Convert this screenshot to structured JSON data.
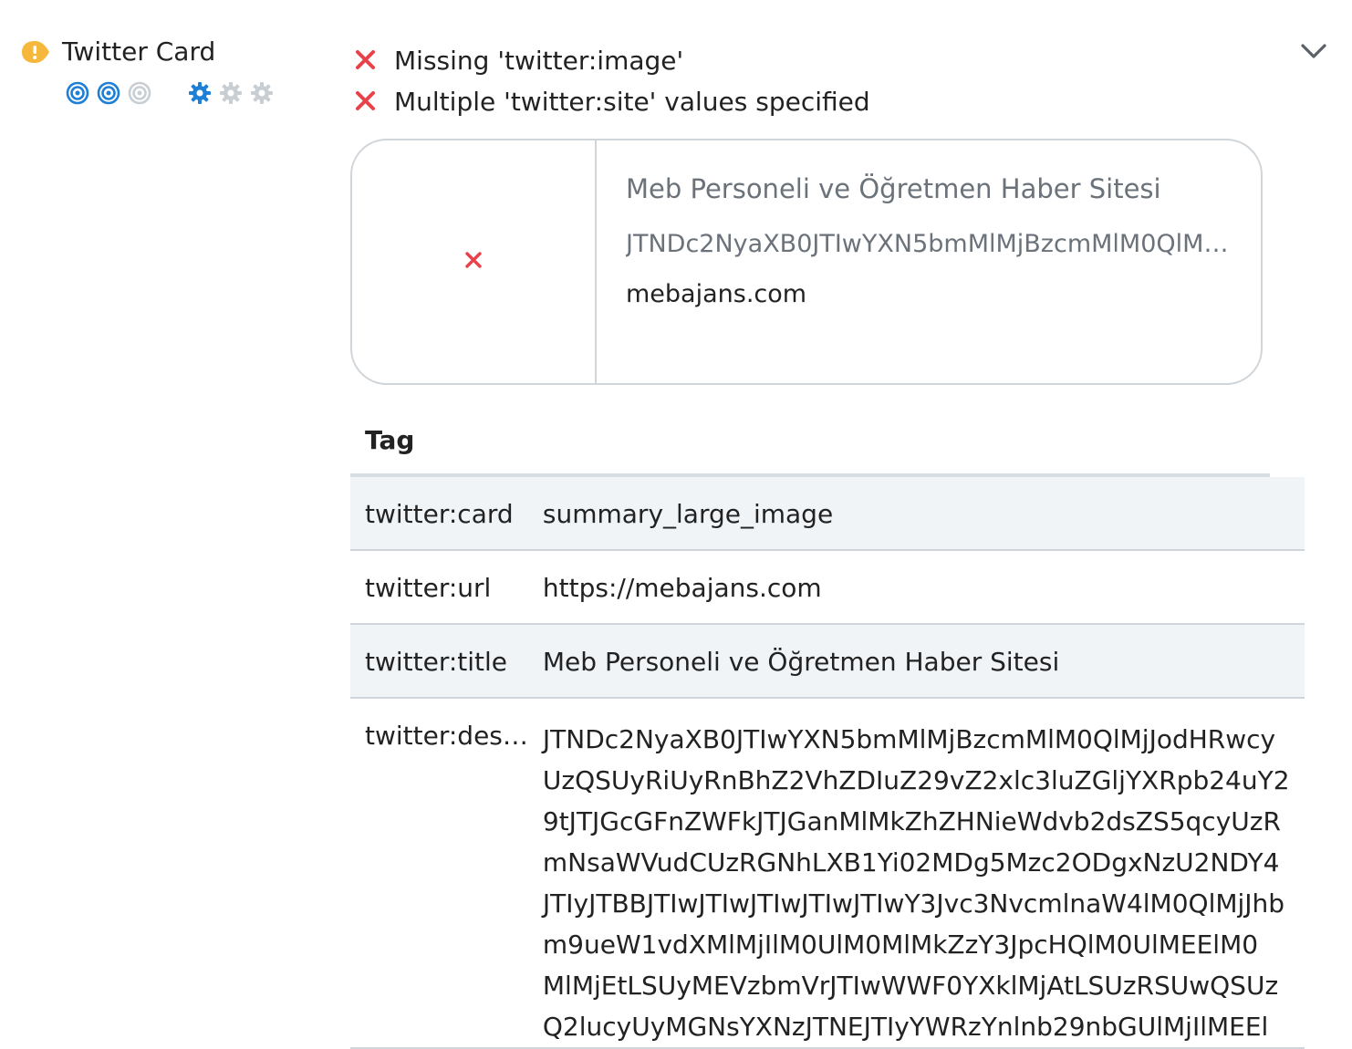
{
  "section": {
    "title": "Twitter Card",
    "status_color": "#f5b83d"
  },
  "issues": [
    {
      "text": "Missing 'twitter:image'"
    },
    {
      "text": "Multiple 'twitter:site' values specified"
    }
  ],
  "card": {
    "title": "Meb Personeli ve Öğretmen Haber Sitesi",
    "description": "JTNDc2NyaXB0JTIwYXN5bmMlMjBzcmMlM0QlMj…",
    "domain": "mebajans.com"
  },
  "table": {
    "header": "Tag",
    "rows": [
      {
        "key": "twitter:card",
        "value": "summary_large_image"
      },
      {
        "key": "twitter:url",
        "value": "https://mebajans.com"
      },
      {
        "key": "twitter:title",
        "value": "Meb Personeli ve Öğretmen Haber Sitesi"
      },
      {
        "key": "twitter:des…",
        "lines": [
          "JTNDc2NyaXB0JTIwYXN5bmMlMjBzcmMlM0QlMjJodHRwcy",
          "UzQSUyRiUyRnBhZ2VhZDIuZ29vZ2xlc3luZGljYXRpb24uY2",
          "9tJTJGcGFnZWFkJTJGanMlMkZhZHNieWdvb2dsZS5qcyUzR",
          "mNsaWVudCUzRGNhLXB1Yi02MDg5Mzc2ODgxNzU2NDY4",
          "JTIyJTBBJTIwJTIwJTIwJTIwJTIwY3Jvc3NvcmlnaW4lM0QlMjJhb",
          "m9ueW1vdXMlMjIlM0UlM0MlMkZzY3JpcHQlM0UlMEElM0",
          "MlMjEtLSUyMEVzbmVrJTIwWWF0YXklMjAtLSUzRSUwQSUz",
          "Q2lucyUyMGNsYXNzJTNEJTIyYWRzYnlnb29nbGUlMjIlMEEl"
        ]
      }
    ]
  },
  "colors": {
    "accent_blue": "#1e7fd6",
    "error_red": "#e8414a",
    "muted_gray": "#c9ced3"
  },
  "icons": {
    "status": "warning-icon",
    "expand": "chevron-down-icon",
    "error": "x-icon"
  }
}
